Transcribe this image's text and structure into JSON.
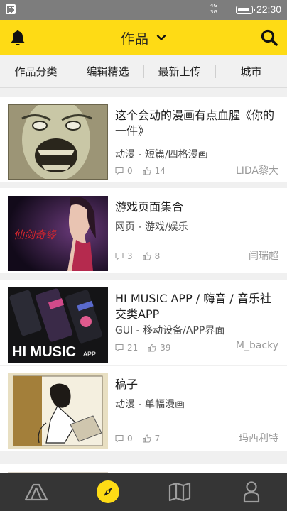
{
  "status_bar": {
    "network_top": "4G",
    "network_bottom": "3G",
    "time": "22:30"
  },
  "header": {
    "title": "作品",
    "accent_color": "#fedb15"
  },
  "tabs": [
    "作品分类",
    "编辑精选",
    "最新上传",
    "城市"
  ],
  "items": [
    {
      "title": "这个会动的漫画有点血腥《你的一件》",
      "category": "动漫 - 短篇/四格漫画",
      "comments": "0",
      "likes": "14",
      "author": "LIDA黎大"
    },
    {
      "title": "游戏页面集合",
      "category": "网页 - 游戏/娱乐",
      "comments": "3",
      "likes": "8",
      "author": "闫瑞超"
    },
    {
      "title": "HI MUSIC APP / 嗨音 / 音乐社交类APP",
      "category": "GUI - 移动设备/APP界面",
      "comments": "21",
      "likes": "39",
      "author": "M_backy",
      "thumb_text": "HI MUSIC",
      "thumb_small": "APP"
    },
    {
      "title": "稿子",
      "category": "动漫 - 单幅漫画",
      "comments": "0",
      "likes": "7",
      "author": "玛西利特"
    }
  ],
  "bottom_nav": [
    {
      "icon": "tent-icon"
    },
    {
      "icon": "compass-icon",
      "active": true
    },
    {
      "icon": "map-icon"
    },
    {
      "icon": "person-icon"
    }
  ]
}
